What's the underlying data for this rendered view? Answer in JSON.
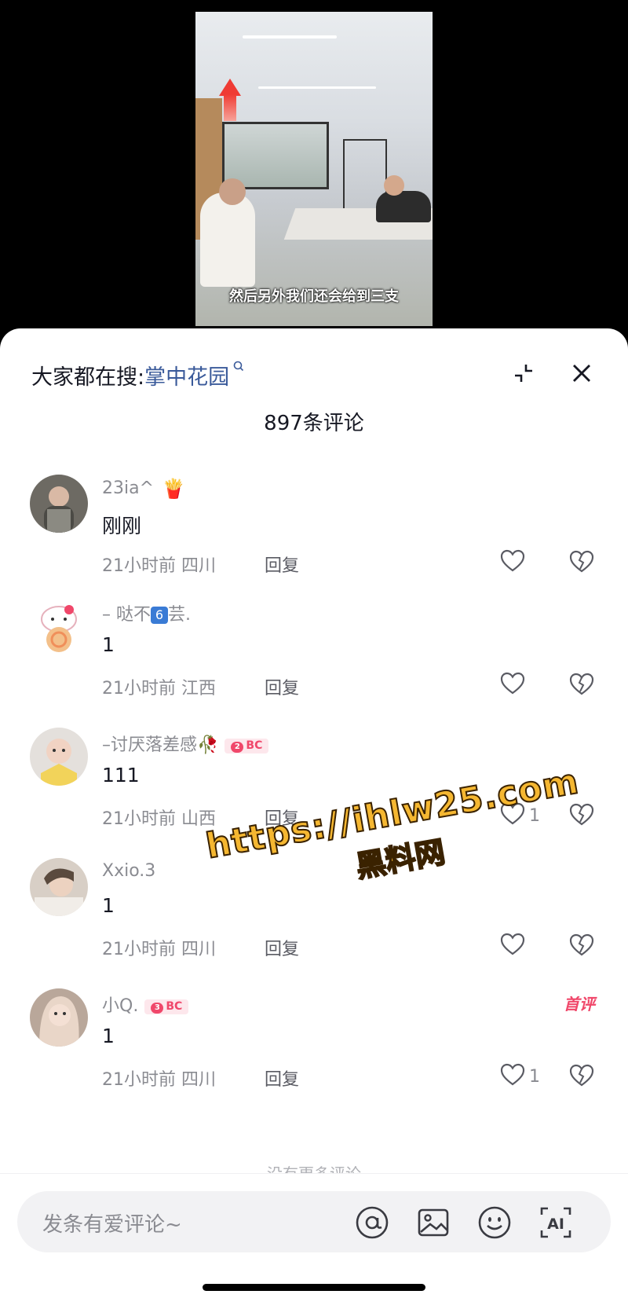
{
  "video": {
    "subtitle": "然后另外我们还会给到三支"
  },
  "header": {
    "search_prefix": "大家都在搜:",
    "search_term": "掌中花园",
    "search_icon": "search-icon",
    "expand_icon": "collapse-arrows-icon",
    "close_icon": "close-icon"
  },
  "comments_count": "897条评论",
  "comments": [
    {
      "nickname": "23ia^",
      "text": "刚刚",
      "time": "21小时前",
      "location": "四川",
      "reply_label": "回复",
      "likes": "",
      "emoji": "🍟"
    },
    {
      "nickname_pre": "– 哒不",
      "nickname_num": "6",
      "nickname_post": "芸.",
      "text": "1",
      "time": "21小时前",
      "location": "江西",
      "reply_label": "回复",
      "likes": ""
    },
    {
      "nickname": "–讨厌落差感🥀",
      "badge_level": "2",
      "badge_text": "BC",
      "text": "111",
      "time": "21小时前",
      "location": "山西",
      "reply_label": "回复",
      "likes": "1"
    },
    {
      "nickname": "Xxio.3",
      "text": "1",
      "time": "21小时前",
      "location": "四川",
      "reply_label": "回复",
      "likes": ""
    },
    {
      "nickname": "小Q.",
      "badge_level": "3",
      "badge_text": "BC",
      "first_tag": "首评",
      "text": "1",
      "time": "21小时前",
      "location": "四川",
      "reply_label": "回复",
      "likes": "1"
    }
  ],
  "end_hint": "没有更多评论",
  "input": {
    "placeholder": "发条有爱评论~",
    "tools": [
      "at-icon",
      "image-icon",
      "emoji-icon",
      "ai-icon"
    ],
    "ai_label": "AI"
  },
  "watermark": {
    "url": "https://ihlw25.com",
    "name": "黑料网"
  }
}
